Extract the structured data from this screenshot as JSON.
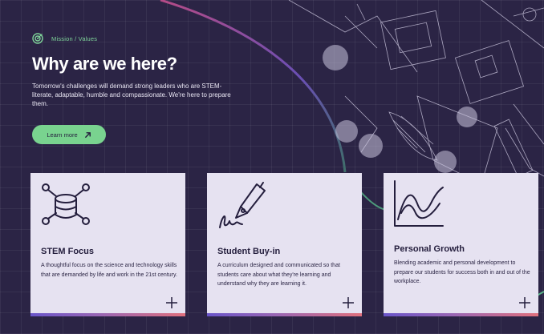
{
  "colors": {
    "background": "#2b2445",
    "accent_green": "#79d38f",
    "card_bg": "#e6e2f1",
    "card_text": "#241e3d",
    "gradient_start": "#6a55c9",
    "gradient_end": "#e0707d"
  },
  "hero": {
    "eyebrow_icon": "target-icon",
    "eyebrow": "Mission / Values",
    "title": "Why are we here?",
    "lead": "Tomorrow's challenges will demand strong leaders who are STEM-literate, adaptable, humble and compassionate. We're here to prepare them.",
    "cta_label": "Learn more",
    "cta_icon": "arrow-up-right-icon"
  },
  "cards": [
    {
      "icon": "database-network-icon",
      "title": "STEM Focus",
      "text": "A thoughtful focus on the science and technology skills that are demanded by life and work in the 21st century.",
      "action_icon": "plus-icon"
    },
    {
      "icon": "pen-signature-icon",
      "title": "Student Buy-in",
      "text": "A curriculum designed and communicated so that students care about what they're learning and understand why they are learning it.",
      "action_icon": "plus-icon"
    },
    {
      "icon": "wave-graph-icon",
      "title": "Personal Growth",
      "text": "Blending academic and personal development to prepare our students for success both in and out of the workplace.",
      "action_icon": "plus-icon"
    }
  ]
}
